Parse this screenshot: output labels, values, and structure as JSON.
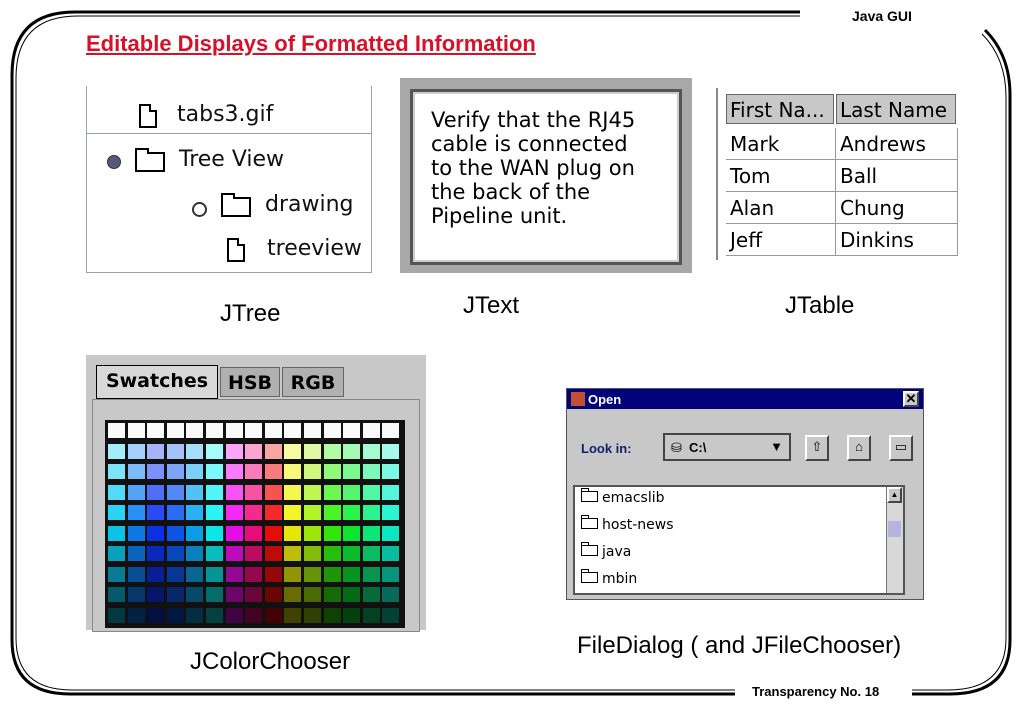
{
  "header": {
    "right_title": "Java GUI",
    "footer": "Transparency No. 18"
  },
  "slide_title": "Editable Displays of Formatted Information",
  "jtree": {
    "caption": "JTree",
    "rows": [
      "tabs3.gif",
      "Tree View",
      "drawing",
      "treeview"
    ]
  },
  "jtext": {
    "caption": "JText",
    "text": "Verify that the RJ45\ncable is connected\nto the WAN plug on\nthe back of the\nPipeline unit."
  },
  "jtable": {
    "caption": "JTable",
    "columns": [
      "First Na...",
      "Last Name"
    ],
    "rows": [
      [
        "Mark",
        "Andrews"
      ],
      [
        "Tom",
        "Ball"
      ],
      [
        "Alan",
        "Chung"
      ],
      [
        "Jeff",
        "Dinkins"
      ]
    ]
  },
  "jcolorchooser": {
    "caption": "JColorChooser",
    "tabs": [
      "Swatches",
      "HSB",
      "RGB"
    ],
    "selected_tab": "Swatches"
  },
  "filedialog": {
    "caption": "FileDialog ( and JFileChooser)",
    "title": "Open",
    "look_in_label": "Look in:",
    "look_in_value": "C:\\",
    "items": [
      "emacslib",
      "host-news",
      "java",
      "mbin"
    ],
    "title_bar_color": "#00037a"
  },
  "colors": {
    "title": "#d8102a",
    "frame": "#000000"
  }
}
